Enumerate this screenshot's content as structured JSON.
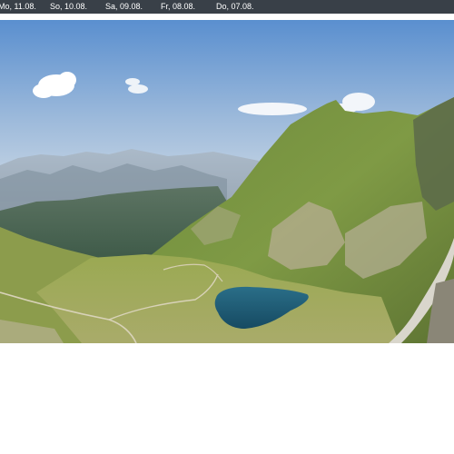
{
  "date_tabs": [
    {
      "label": "Mo, 11.08."
    },
    {
      "label": "So, 10.08."
    },
    {
      "label": "Sa, 09.08."
    },
    {
      "label": "Fr, 08.08."
    },
    {
      "label": "Do, 07.08."
    }
  ],
  "colors": {
    "bar": "#394048",
    "sky_top": "#5f92cf",
    "sky_horizon": "#c9d8e6",
    "grass": "#8fa34a",
    "lake": "#1f5d78"
  }
}
